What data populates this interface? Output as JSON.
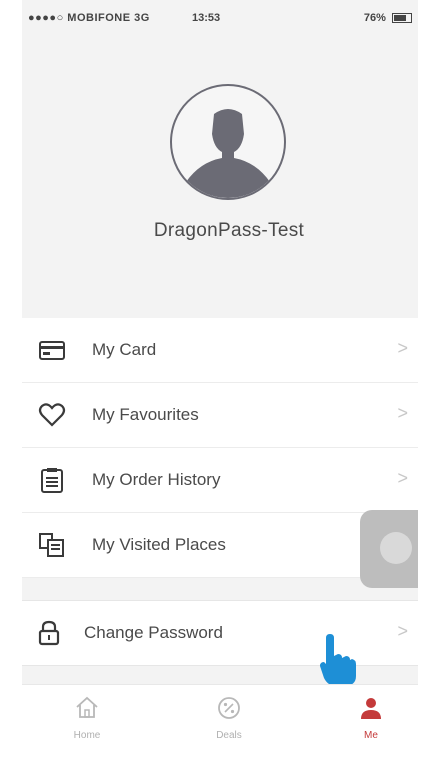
{
  "status_bar": {
    "carrier": "●●●●○ MOBIFONE  3G",
    "time": "13:53",
    "battery": "76%"
  },
  "profile": {
    "username": "DragonPass-Test"
  },
  "menu": {
    "items": [
      {
        "label": "My Card",
        "icon": "card-icon"
      },
      {
        "label": "My Favourites",
        "icon": "heart-icon"
      },
      {
        "label": "My Order History",
        "icon": "clipboard-icon"
      },
      {
        "label": "My Visited Places",
        "icon": "visited-places-icon"
      }
    ],
    "change_password": {
      "label": "Change Password",
      "icon": "lock-icon"
    },
    "chevron": ">"
  },
  "tabbar": {
    "tabs": [
      {
        "label": "Home",
        "icon": "home-icon",
        "active": false
      },
      {
        "label": "Deals",
        "icon": "deals-icon",
        "active": false
      },
      {
        "label": "Me",
        "icon": "person-icon",
        "active": true
      }
    ]
  },
  "colors": {
    "accent": "#c43a3a",
    "background": "#f3f3f3",
    "pointer_hand": "#1e8fd6"
  }
}
